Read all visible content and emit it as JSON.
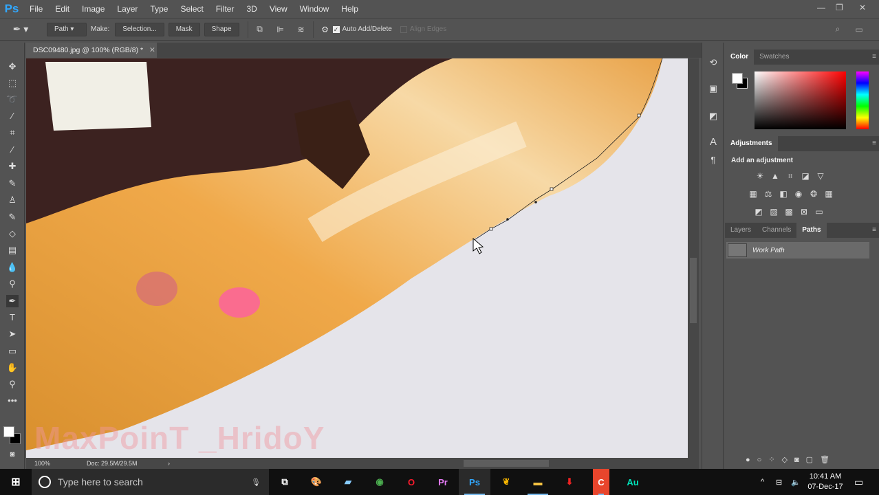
{
  "app": {
    "logo": "Ps",
    "menu": [
      "File",
      "Edit",
      "Image",
      "Layer",
      "Type",
      "Select",
      "Filter",
      "3D",
      "View",
      "Window",
      "Help"
    ]
  },
  "options": {
    "mode": "Path",
    "make_label": "Make:",
    "selection": "Selection...",
    "mask": "Mask",
    "shape": "Shape",
    "auto_add_delete": "Auto Add/Delete",
    "auto_add_checked": true,
    "align_edges": "Align Edges"
  },
  "document": {
    "tab_title": "DSC09480.jpg @ 100% (RGB/8) *",
    "watermark": "MaxPoinT _HridoY"
  },
  "status": {
    "zoom": "100%",
    "doc": "Doc: 29.5M/29.5M"
  },
  "panels": {
    "color_tabs": [
      "Color",
      "Swatches"
    ],
    "adjustments_tab": "Adjustments",
    "add_adjustment": "Add an adjustment",
    "layer_tabs": [
      "Layers",
      "Channels",
      "Paths"
    ],
    "paths": [
      {
        "name": "Work Path"
      }
    ]
  },
  "taskbar": {
    "search_placeholder": "Type here to search",
    "apps": [
      {
        "label": "Pr",
        "color": "#e77cf7"
      },
      {
        "label": "Ps",
        "color": "#31a8ff",
        "active": true
      },
      {
        "label": "Au",
        "color": "#00e4bb"
      }
    ],
    "time": "10:41 AM",
    "date": "07-Dec-17"
  }
}
